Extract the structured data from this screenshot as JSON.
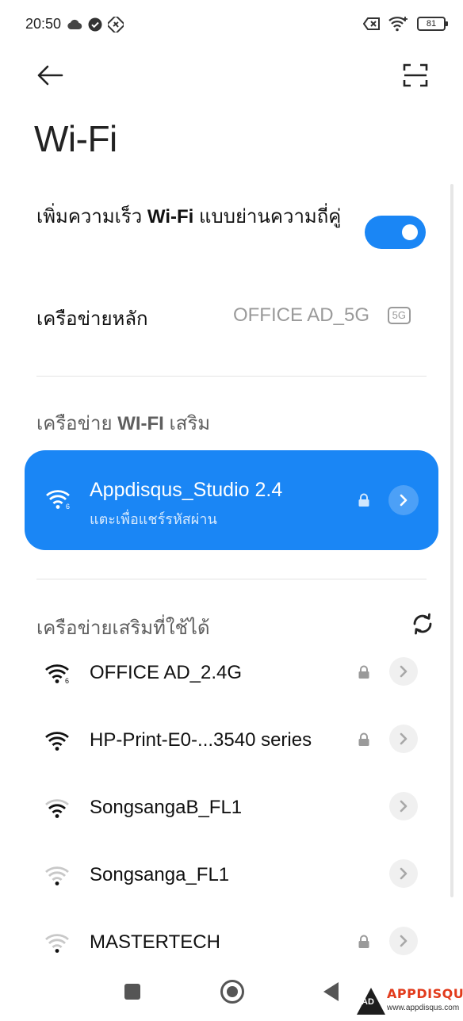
{
  "status_bar": {
    "time": "20:50",
    "battery": "81",
    "left_icons": [
      "cloud-icon",
      "check-circle-icon",
      "nfc-icon"
    ],
    "right_icons": [
      "sim-off-icon",
      "wifi-6-signal-icon",
      "battery-icon"
    ]
  },
  "header": {
    "title": "Wi-Fi",
    "back_icon": "arrow-left-icon",
    "scan_icon": "qr-scan-icon"
  },
  "boost": {
    "text_before": "เพิ่มความเร็ว ",
    "text_bold": "Wi-Fi",
    "text_after": " แบบย่านความถี่คู่",
    "enabled": true
  },
  "primary_network": {
    "label": "เครือข่ายหลัก",
    "value": "OFFICE AD_5G",
    "badge": "5G"
  },
  "secondary_section": {
    "title_before": "เครือข่าย ",
    "title_bold": "WI-FI",
    "title_after": " เสริม"
  },
  "active_network": {
    "name": "Appdisqus_Studio 2.4",
    "subtitle": "แตะเพื่อแชร์รหัสผ่าน",
    "locked": true,
    "wifi6": true
  },
  "available_section": {
    "title": "เครือข่ายเสริมที่ใช้ได้",
    "refresh_icon": "refresh-icon"
  },
  "networks": [
    {
      "name": "OFFICE AD_2.4G",
      "locked": true,
      "signal": 4,
      "wifi6": true
    },
    {
      "name": "HP-Print-E0-...3540 series",
      "locked": true,
      "signal": 4,
      "wifi6": false
    },
    {
      "name": "SongsangaB_FL1",
      "locked": false,
      "signal": 3,
      "wifi6": false
    },
    {
      "name": "Songsanga_FL1",
      "locked": false,
      "signal": 1,
      "wifi6": false
    },
    {
      "name": "MASTERTECH",
      "locked": true,
      "signal": 1,
      "wifi6": false
    }
  ],
  "colors": {
    "accent": "#1a86f5",
    "text_primary": "#111111",
    "text_secondary": "#5f5f5f",
    "text_muted": "#9a9a9a"
  },
  "watermark": {
    "logo": "APPDISQUS",
    "badge": "AD",
    "url": "www.appdisqus.com"
  }
}
